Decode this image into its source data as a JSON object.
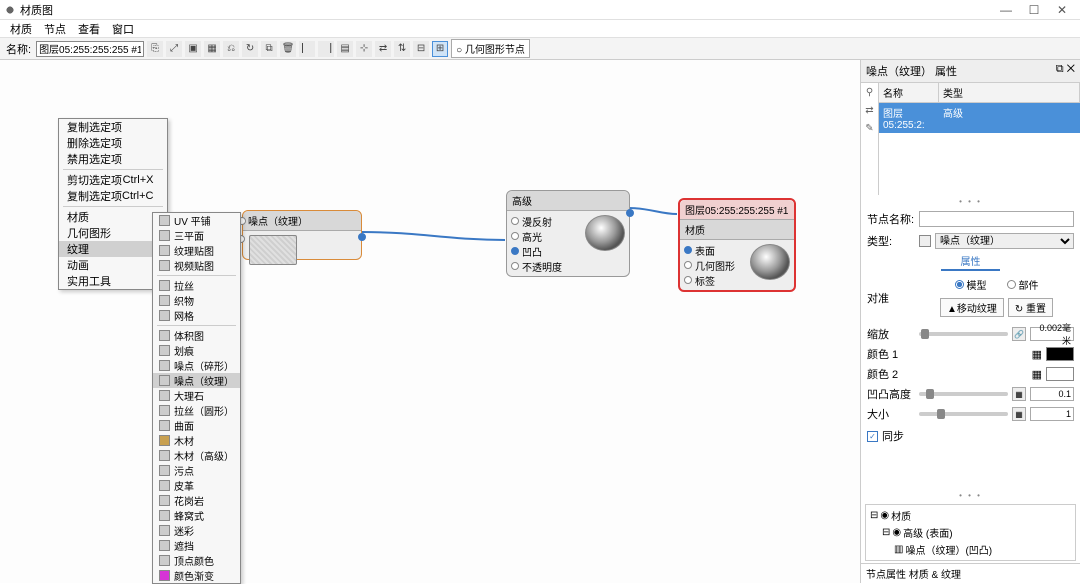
{
  "window": {
    "title": "材质图"
  },
  "menubar": [
    "材质",
    "节点",
    "查看",
    "窗口"
  ],
  "toolbar": {
    "name_label": "名称:",
    "name_value": "图层05:255:255:255 #1",
    "search_prefix": "○",
    "search_label": "几何图形节点"
  },
  "context_menu": {
    "items": [
      {
        "label": "复制选定项"
      },
      {
        "label": "删除选定项"
      },
      {
        "label": "禁用选定项"
      },
      {
        "sep": true
      },
      {
        "label": "剪切选定项",
        "shortcut": "Ctrl+X"
      },
      {
        "label": "复制选定项",
        "shortcut": "Ctrl+C"
      },
      {
        "sep": true
      },
      {
        "label": "材质",
        "arrow": true
      },
      {
        "label": "几何图形",
        "arrow": true
      },
      {
        "label": "纹理",
        "arrow": true,
        "hover": true
      },
      {
        "label": "动画",
        "arrow": true
      },
      {
        "label": "实用工具",
        "arrow": true
      }
    ]
  },
  "submenu": {
    "items": [
      {
        "label": "UV 平铺"
      },
      {
        "label": "三平面"
      },
      {
        "label": "纹理贴图"
      },
      {
        "label": "视频贴图"
      },
      {
        "sep": true
      },
      {
        "label": "拉丝"
      },
      {
        "label": "织物"
      },
      {
        "label": "网格"
      },
      {
        "sep": true
      },
      {
        "label": "体积图"
      },
      {
        "label": "划痕"
      },
      {
        "label": "噪点（碎形）"
      },
      {
        "label": "噪点（纹理）",
        "hover": true
      },
      {
        "label": "大理石"
      },
      {
        "label": "拉丝（圆形）"
      },
      {
        "label": "曲面"
      },
      {
        "label": "木材"
      },
      {
        "label": "木材（高级）"
      },
      {
        "label": "污点"
      },
      {
        "label": "皮革"
      },
      {
        "label": "花岗岩"
      },
      {
        "label": "蜂窝式"
      },
      {
        "label": "迷彩"
      },
      {
        "label": "遮挡"
      },
      {
        "label": "顶点颜色"
      },
      {
        "label": "颜色渐变",
        "color": "#d633d6"
      }
    ]
  },
  "nodes": {
    "noise": {
      "title": "噪点（纹理）"
    },
    "advanced": {
      "title": "高级",
      "ports": [
        "漫反射",
        "高光",
        "凹凸",
        "不透明度"
      ],
      "active_port": 2
    },
    "layer": {
      "hdr1": "图层05:255:255:255 #1",
      "hdr2": "材质",
      "ports": [
        "表面",
        "几何图形",
        "标签"
      ],
      "active_port": 0
    }
  },
  "side": {
    "panel_title": "噪点（纹理） 属性",
    "list_hdr": {
      "c1": "名称",
      "c2": "类型"
    },
    "list_row": {
      "c1": "图层05:255:2:",
      "c2": "高级"
    },
    "node_name_label": "节点名称:",
    "node_name_value": "",
    "type_label": "类型:",
    "type_value": "噪点（纹理）",
    "tabs": {
      "attr": "属性"
    },
    "align_label": "对准",
    "radios": {
      "model": "模型",
      "part": "部件"
    },
    "btns": {
      "move": "▲移动纹理",
      "reset": "↻ 重置"
    },
    "scale_label": "缩放",
    "scale_value": "0.002毫米",
    "color1_label": "颜色 1",
    "color2_label": "颜色 2",
    "bump_label": "凹凸高度",
    "bump_value": "0.1",
    "size_label": "大小",
    "size_value": "1",
    "sync_label": "同步",
    "tree": {
      "root": "材质",
      "l1": "高级  (表面)",
      "l2": "噪点（纹理）(凹凸)"
    },
    "status": "节点属性   材质 & 纹理"
  }
}
